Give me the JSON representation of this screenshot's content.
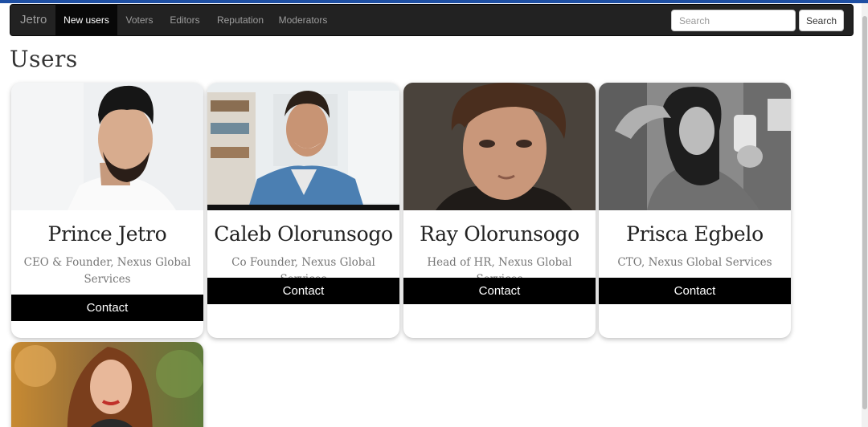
{
  "navbar": {
    "brand": "Jetro",
    "items": [
      {
        "label": "New users",
        "active": true
      },
      {
        "label": "Voters",
        "active": false
      },
      {
        "label": "Editors",
        "active": false
      },
      {
        "label": "Reputation",
        "active": false
      },
      {
        "label": "Moderators",
        "active": false
      }
    ],
    "search_placeholder": "Search",
    "search_button": "Search"
  },
  "page": {
    "title": "Users"
  },
  "users": [
    {
      "name": "Prince Jetro",
      "role": "CEO & Founder, Nexus Global Services",
      "contact_label": "Contact",
      "photo": "man-dark-hair-beard-portrait"
    },
    {
      "name": "Caleb Olorunsogo",
      "role": "Co Founder, Nexus Global Services",
      "contact_label": "Contact",
      "photo": "smiling-man-denim-shirt-bookshelf"
    },
    {
      "name": "Ray Olorunsogo",
      "role": "Head of HR, Nexus Global Services",
      "contact_label": "Contact",
      "photo": "young-man-brown-hair-portrait"
    },
    {
      "name": "Prisca Egbelo",
      "role": "CTO, Nexus Global Services",
      "contact_label": "Contact",
      "photo": "woman-selfie-black-white"
    },
    {
      "name": "",
      "role": "",
      "contact_label": "",
      "photo": "woman-autumn-portrait"
    }
  ],
  "colors": {
    "navbar_bg": "#222222",
    "active_nav_bg": "#080808",
    "contact_bg": "#000000",
    "accent_strip": "#1e4fa3"
  }
}
